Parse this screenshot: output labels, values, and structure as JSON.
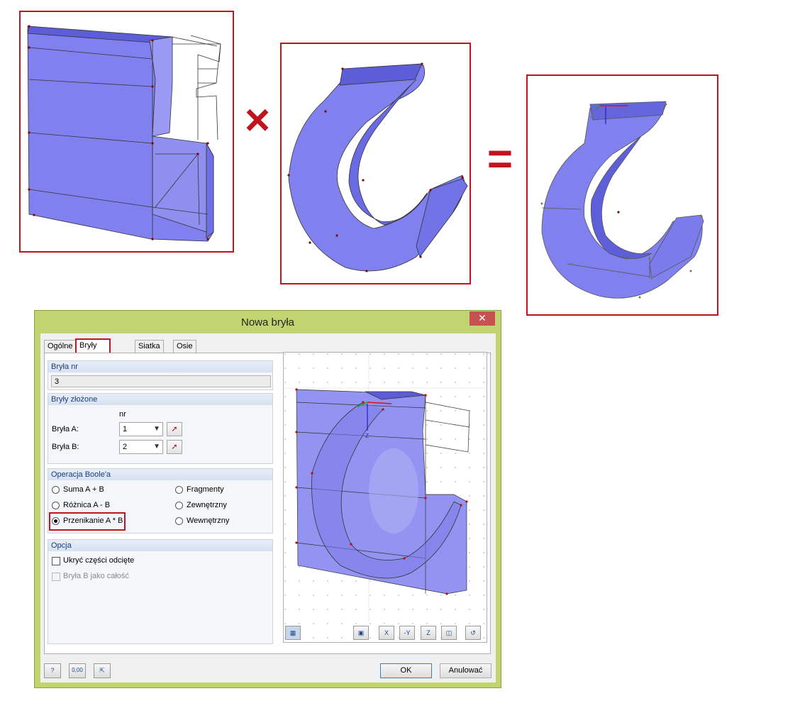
{
  "figure": {
    "operator_times": "×",
    "operator_equals": "="
  },
  "dialog": {
    "title": "Nowa bryła",
    "close_glyph": "✕",
    "tabs": [
      {
        "label": "Ogólne"
      },
      {
        "label": "Bryły złożone"
      },
      {
        "label": "Siatka ES"
      },
      {
        "label": "Osie"
      }
    ],
    "active_tab": "Bryły złożone",
    "solid_no": {
      "header": "Bryła nr",
      "value": "3"
    },
    "composite": {
      "header": "Bryły złożone",
      "col_header": "nr",
      "solid_a_label": "Bryła A:",
      "solid_a_value": "1",
      "solid_b_label": "Bryła B:",
      "solid_b_value": "2"
    },
    "boolean": {
      "header": "Operacja Boole'a",
      "options": [
        {
          "label": "Suma A + B",
          "selected": false
        },
        {
          "label": "Różnica A - B",
          "selected": false
        },
        {
          "label": "Przenikanie A * B",
          "selected": true
        },
        {
          "label": "Fragmenty",
          "selected": false
        },
        {
          "label": "Zewnętrzny",
          "selected": false
        },
        {
          "label": "Wewnętrzny",
          "selected": false
        }
      ]
    },
    "option": {
      "header": "Opcja",
      "hide_cut": {
        "label": "Ukryć części odcięte",
        "checked": false,
        "enabled": true
      },
      "solid_b_whole": {
        "label": "Bryła B jako całość",
        "checked": false,
        "enabled": false
      }
    },
    "preview_axis_label": "Z",
    "preview_toolbar": [
      {
        "icon": "display-options-icon"
      },
      {
        "icon": "view-mode-icon"
      },
      {
        "icon": "view-x-icon",
        "text": "X"
      },
      {
        "icon": "view-neg-y-icon",
        "text": "-Y"
      },
      {
        "icon": "view-z-icon",
        "text": "Z"
      },
      {
        "icon": "isometric-view-icon"
      },
      {
        "icon": "reset-view-icon"
      }
    ],
    "footer": {
      "help_icon": "help-icon",
      "units_icon_text": "0,00",
      "pick_icon": "pick-from-graphics-icon",
      "ok_label": "OK",
      "cancel_label": "Anulować"
    }
  },
  "colors": {
    "solid_fill": "#8080ee",
    "frame_red": "#c0141e",
    "dialog_frame": "#c2d470",
    "node_dot": "#8b0000"
  }
}
